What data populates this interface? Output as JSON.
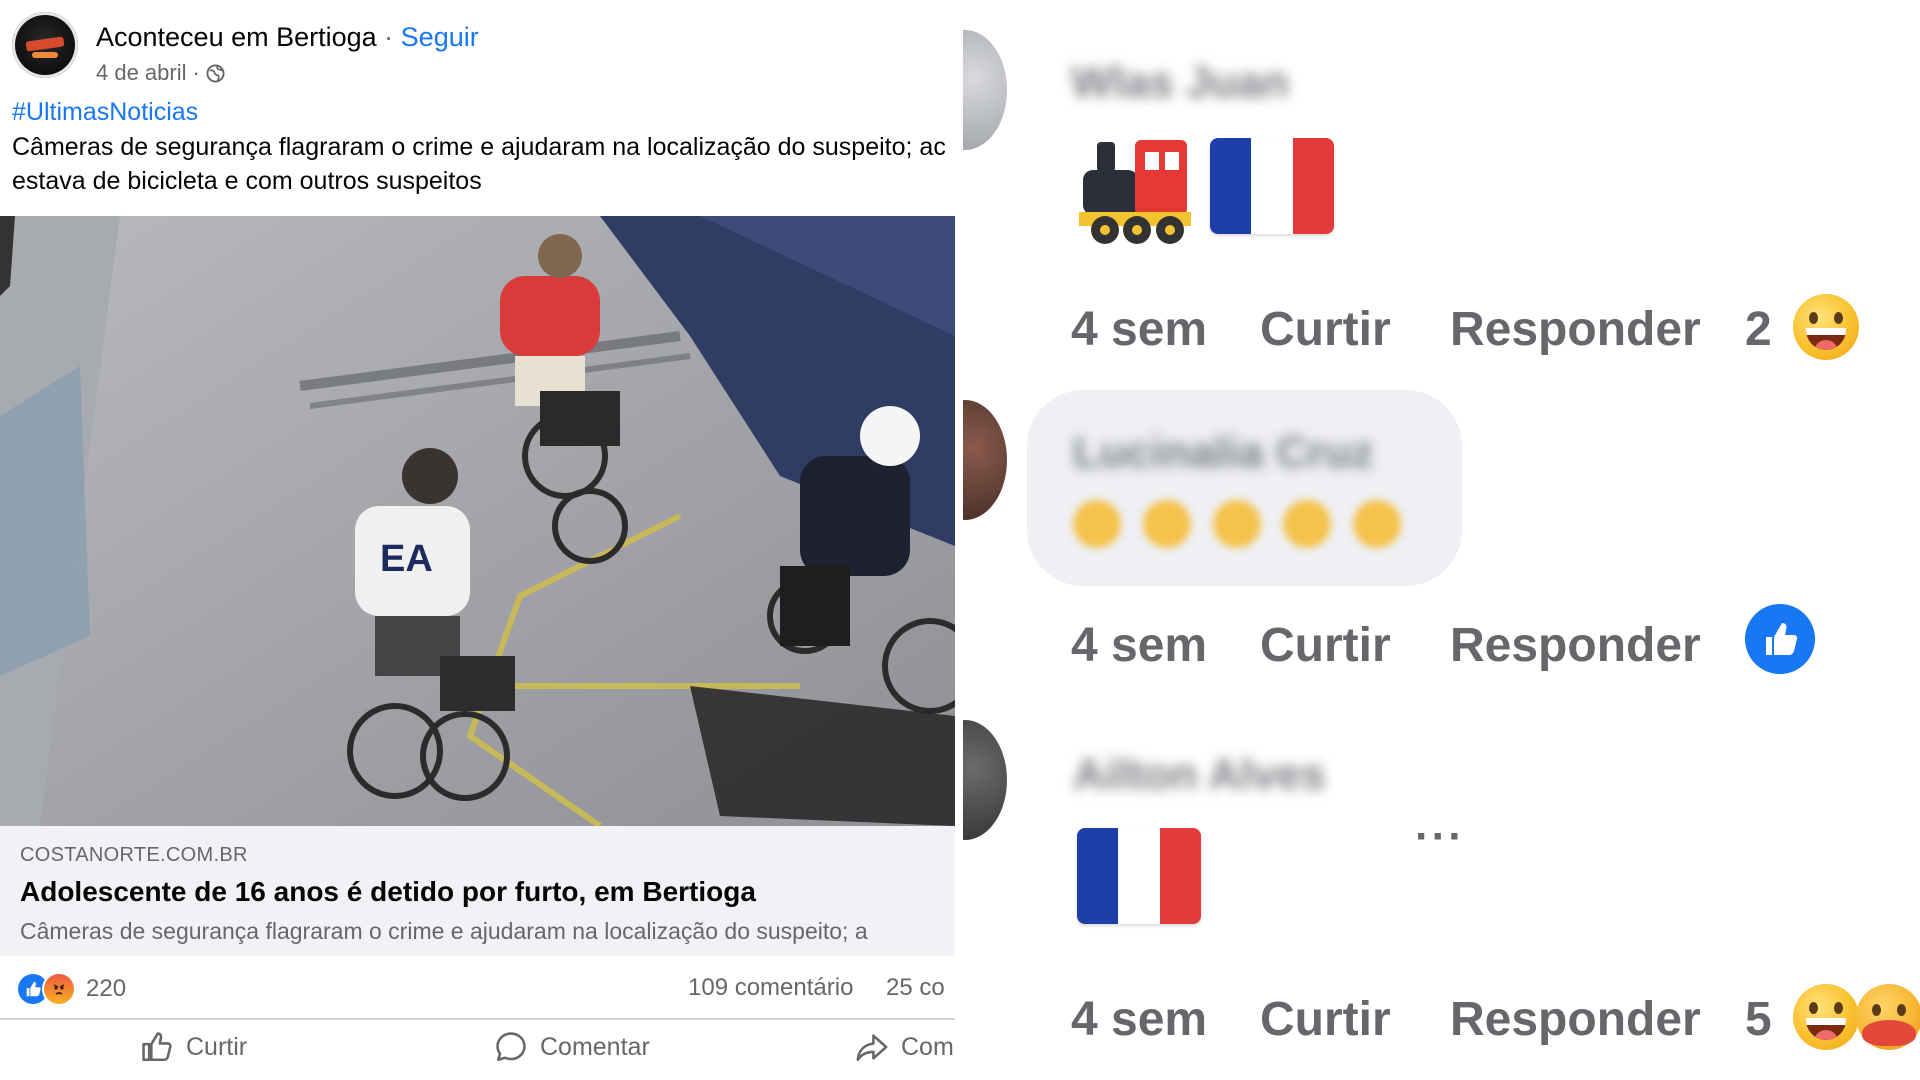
{
  "post": {
    "page_name": "Aconteceu em Bertioga",
    "separator": " · ",
    "follow_label": "Seguir",
    "date": "4 de abril",
    "meta_sep": "·",
    "hashtag": "#UltimasNoticias",
    "text_line1": "Câmeras de segurança flagraram o crime e ajudaram na localização do suspeito; ac",
    "text_line2": "estava de bicicleta e com outros suspeitos",
    "link": {
      "domain": "COSTANORTE.COM.BR",
      "title": "Adolescente de 16 anos é detido por furto, em Bertioga",
      "description": "Câmeras de segurança flagraram o crime e ajudaram na localização do suspeito; a"
    },
    "stats": {
      "reaction_count": "220",
      "comments": "109 comentário",
      "shares": "25 co"
    },
    "actions": {
      "like": "Curtir",
      "comment": "Comentar",
      "share": "Com"
    }
  },
  "comments": [
    {
      "name": "Wlas Juan",
      "time": "4 sem",
      "like": "Curtir",
      "reply": "Responder",
      "reaction_count": "2",
      "content_icons": [
        "locomotive-emoji",
        "france-flag-emoji"
      ]
    },
    {
      "name": "Lucinalia Cruz",
      "time": "4 sem",
      "like": "Curtir",
      "reply": "Responder",
      "reaction_count": "",
      "content_icons": [
        "yellow-emoji-row"
      ]
    },
    {
      "name": "Ailton Alves",
      "time": "4 sem",
      "like": "Curtir",
      "reply": "Responder",
      "reaction_count": "5",
      "more": "···",
      "content_icons": [
        "france-flag-emoji"
      ]
    }
  ],
  "colors": {
    "facebook_blue": "#1877f2",
    "secondary_text": "#65676b",
    "flag_blue": "#1f3fa8",
    "flag_red": "#e23b3b"
  }
}
